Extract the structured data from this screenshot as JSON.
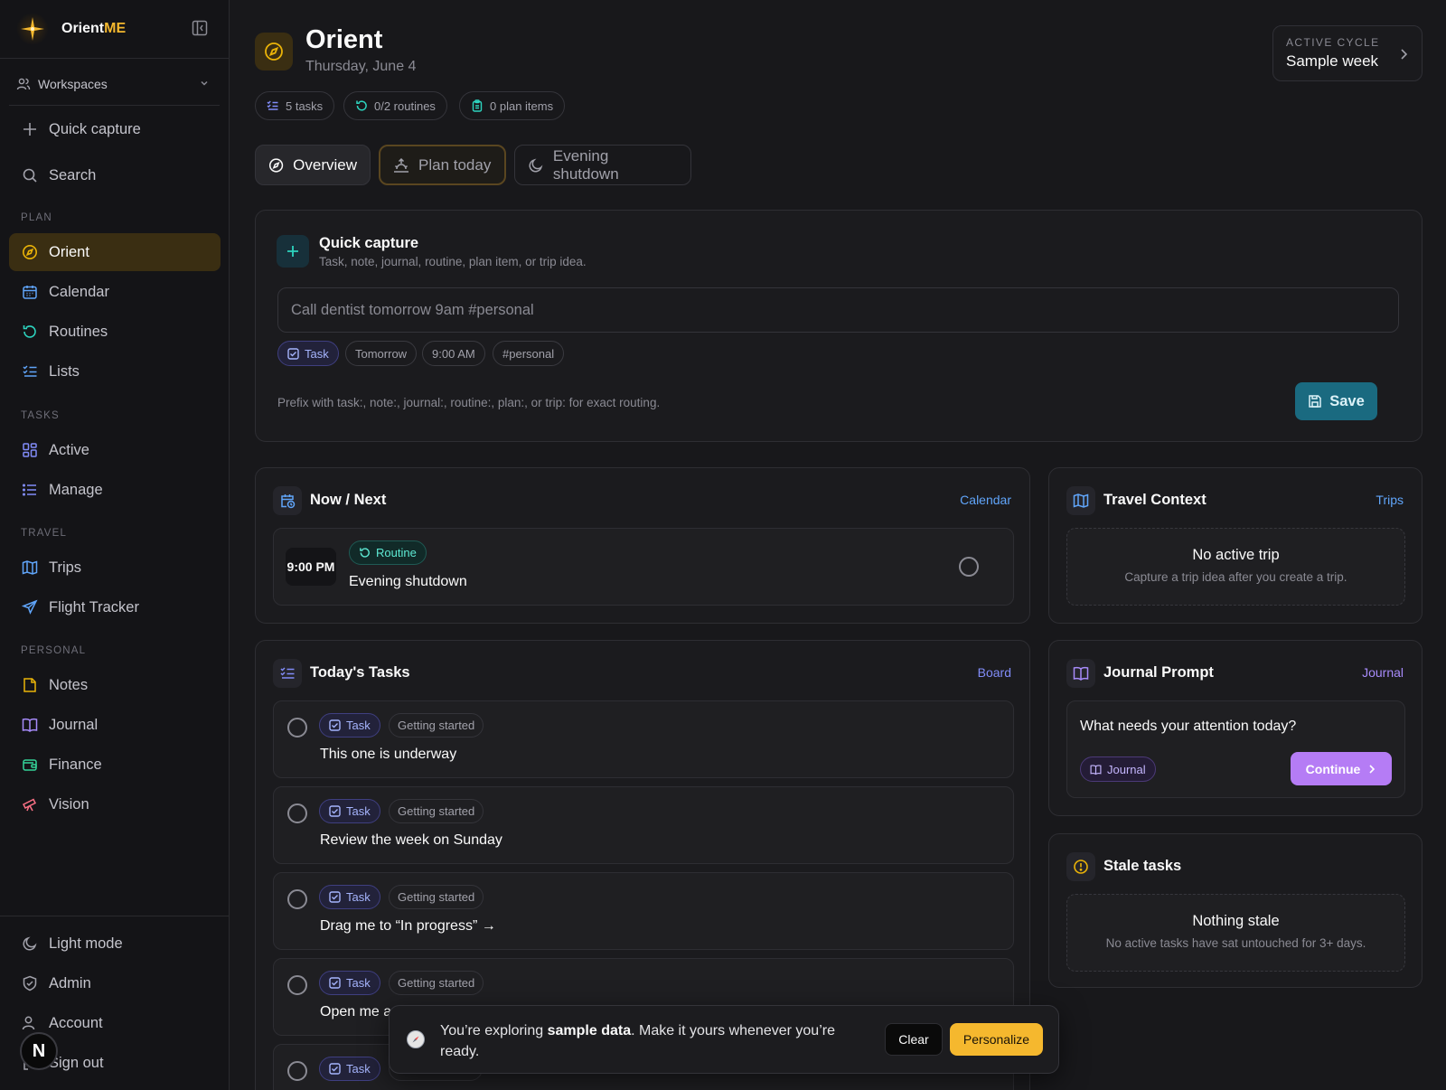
{
  "app": {
    "name_prefix": "Orient",
    "name_suffix": "ME",
    "accent": "#f5b82e"
  },
  "sidebar": {
    "workspaces_label": "Workspaces",
    "quick_capture": "Quick capture",
    "search": "Search",
    "sections": {
      "plan": "PLAN",
      "tasks": "TASKS",
      "travel": "TRAVEL",
      "personal": "PERSONAL"
    },
    "plan_items": [
      {
        "label": "Orient",
        "icon": "compass-icon",
        "active": true
      },
      {
        "label": "Calendar",
        "icon": "calendar-icon"
      },
      {
        "label": "Routines",
        "icon": "refresh-icon"
      },
      {
        "label": "Lists",
        "icon": "list-checks-icon"
      }
    ],
    "task_items": [
      {
        "label": "Active",
        "icon": "grid-icon"
      },
      {
        "label": "Manage",
        "icon": "list-icon"
      }
    ],
    "travel_items": [
      {
        "label": "Trips",
        "icon": "map-icon"
      },
      {
        "label": "Flight Tracker",
        "icon": "plane-icon"
      }
    ],
    "personal_items": [
      {
        "label": "Notes",
        "icon": "note-icon"
      },
      {
        "label": "Journal",
        "icon": "book-icon"
      },
      {
        "label": "Finance",
        "icon": "wallet-icon"
      },
      {
        "label": "Vision",
        "icon": "telescope-icon"
      }
    ],
    "footer_items": [
      {
        "label": "Light mode",
        "icon": "moon-icon"
      },
      {
        "label": "Admin",
        "icon": "shield-icon"
      },
      {
        "label": "Account",
        "icon": "user-icon"
      },
      {
        "label": "Sign out",
        "icon": "logout-icon"
      }
    ],
    "avatar_letter": "N"
  },
  "header": {
    "title": "Orient",
    "date": "Thursday, June 4",
    "chips": {
      "tasks": "5 tasks",
      "routines": "0/2 routines",
      "plan_items": "0 plan items"
    },
    "active_cycle_label": "ACTIVE CYCLE",
    "active_cycle_value": "Sample week"
  },
  "tabs": {
    "overview": "Overview",
    "plan_today": "Plan today",
    "evening_shutdown": "Evening shutdown"
  },
  "quick_capture": {
    "title": "Quick capture",
    "subtitle": "Task, note, journal, routine, plan item, or trip idea.",
    "input_value": "Call dentist tomorrow 9am #personal",
    "parsed": {
      "type": "Task",
      "date": "Tomorrow",
      "time": "9:00 AM",
      "tag": "#personal"
    },
    "hint": "Prefix with task:, note:, journal:, routine:, plan:, or trip: for exact routing.",
    "save_label": "Save"
  },
  "now_next": {
    "title": "Now / Next",
    "link": "Calendar",
    "items": [
      {
        "time": "9:00 PM",
        "kind": "Routine",
        "title": "Evening shutdown"
      }
    ]
  },
  "travel_context": {
    "title": "Travel Context",
    "link": "Trips",
    "empty_title": "No active trip",
    "empty_sub": "Capture a trip idea after you create a trip."
  },
  "todays_tasks": {
    "title": "Today's Tasks",
    "link": "Board",
    "items": [
      {
        "kind": "Task",
        "stage": "Getting started",
        "title": "This one is underway"
      },
      {
        "kind": "Task",
        "stage": "Getting started",
        "title": "Review the week on Sunday"
      },
      {
        "kind": "Task",
        "stage": "Getting started",
        "title": "Drag me to “In progress” →"
      },
      {
        "kind": "Task",
        "stage": "Getting started",
        "title": "Open me a"
      },
      {
        "kind": "Task",
        "stage": "",
        "title": ""
      }
    ]
  },
  "journal_prompt": {
    "title": "Journal Prompt",
    "link": "Journal",
    "question": "What needs your attention today?",
    "pill": "Journal",
    "continue_label": "Continue"
  },
  "stale_tasks": {
    "title": "Stale tasks",
    "empty_title": "Nothing stale",
    "empty_sub": "No active tasks have sat untouched for 3+ days."
  },
  "toast": {
    "text_before": "You’re exploring ",
    "text_bold": "sample data",
    "text_after": ". Make it yours whenever you’re ready.",
    "clear_label": "Clear",
    "personalize_label": "Personalize"
  },
  "colors": {
    "plan_icon": "#eab308",
    "calendar_icon": "#60a5fa",
    "routines_icon": "#2dd4bf",
    "tasks_icon": "#818cf8",
    "travel_icon": "#60a5fa",
    "notes_icon": "#eab308",
    "journal_icon": "#a78bfa",
    "finance_icon": "#34d399",
    "vision_icon": "#fb7185"
  }
}
